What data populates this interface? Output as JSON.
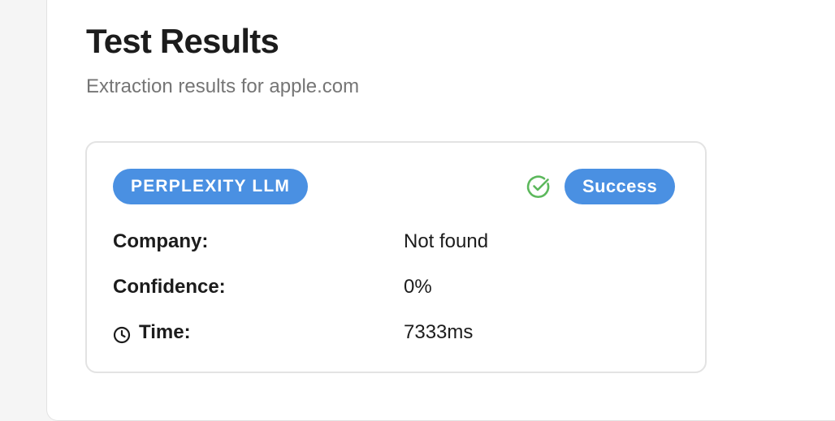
{
  "page": {
    "title": "Test Results",
    "subtitle": "Extraction results for apple.com"
  },
  "result": {
    "provider": "PERPLEXITY LLM",
    "status_icon": "check-circle-icon",
    "status": "Success",
    "fields": [
      {
        "label": "Company:",
        "value": "Not found"
      },
      {
        "label": "Confidence:",
        "value": "0%"
      },
      {
        "label": "Time:",
        "value": "7333ms",
        "icon": "clock-icon"
      }
    ]
  },
  "colors": {
    "badge": "#4a90e2",
    "success_icon": "#5cb85c",
    "text": "#1c1c1c",
    "muted": "#757575"
  }
}
